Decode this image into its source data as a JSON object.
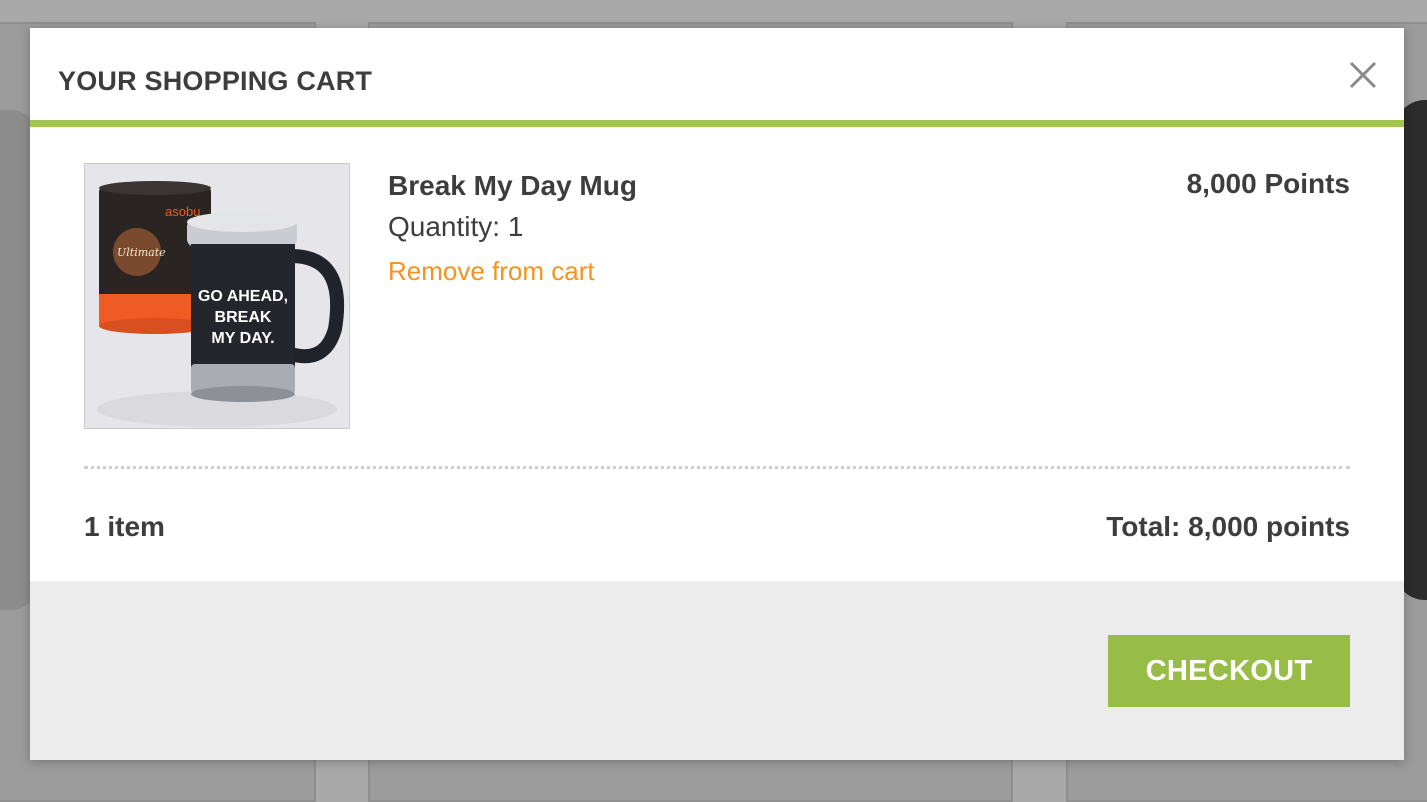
{
  "cart": {
    "title": "YOUR SHOPPING CART",
    "close_icon": "close-icon",
    "accent_color": "#a3c64d",
    "items": [
      {
        "name": "Break My Day Mug",
        "quantity_label": "Quantity:",
        "quantity": "1",
        "remove_label": "Remove from cart",
        "price": "8,000 Points",
        "image": {
          "canister_brand": "asobu",
          "canister_script": "Ultimate",
          "mug_text_line1": "GO AHEAD,",
          "mug_text_line2": "BREAK",
          "mug_text_line3": "MY DAY."
        }
      }
    ],
    "summary": {
      "count": "1 item",
      "total": "Total: 8,000 points"
    },
    "checkout_label": "CHECKOUT",
    "checkout_color": "#98bd47",
    "link_color": "#f4931e"
  }
}
